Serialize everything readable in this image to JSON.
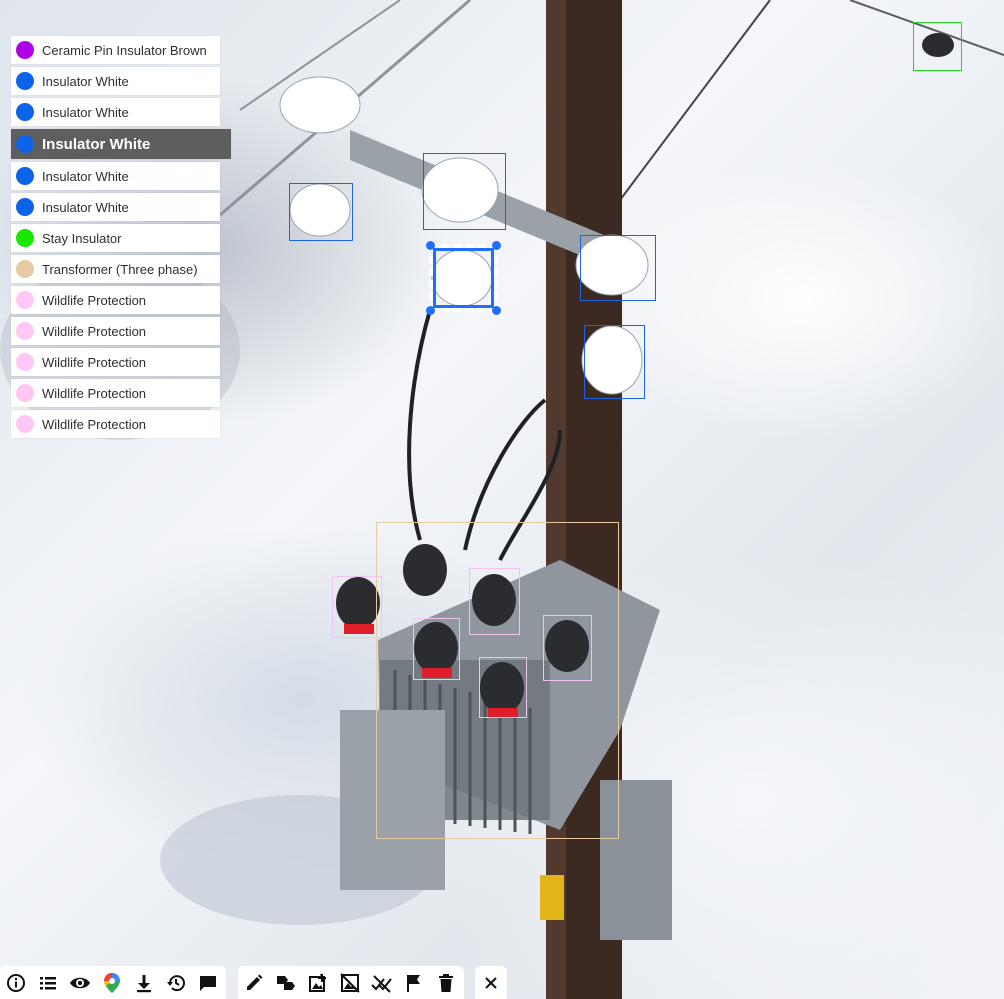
{
  "legend": {
    "items": [
      {
        "label": "Ceramic Pin Insulator Brown",
        "color": "#b000e8"
      },
      {
        "label": "Insulator White",
        "color": "#0a63e8"
      },
      {
        "label": "Insulator White",
        "color": "#0a63e8"
      },
      {
        "label": "Insulator White",
        "color": "#0a63e8",
        "selected": true
      },
      {
        "label": "Insulator White",
        "color": "#0a63e8"
      },
      {
        "label": "Insulator White",
        "color": "#0a63e8"
      },
      {
        "label": "Stay Insulator",
        "color": "#18e800"
      },
      {
        "label": "Transformer (Three phase)",
        "color": "#e6cba2"
      },
      {
        "label": "Wildlife Protection",
        "color": "#ffc8f4"
      },
      {
        "label": "Wildlife Protection",
        "color": "#ffc8f4"
      },
      {
        "label": "Wildlife Protection",
        "color": "#ffc8f4"
      },
      {
        "label": "Wildlife Protection",
        "color": "#ffc8f4"
      },
      {
        "label": "Wildlife Protection",
        "color": "#ffc8f4"
      }
    ]
  },
  "annotations": {
    "insulator_color": "#1f63e0",
    "stay_color": "#22d61a",
    "transformer_color": "#e6cba2",
    "wildlife_color": "#f2c3ee",
    "selected_color": "#1f6fff"
  },
  "toolbar_left": {
    "icons": [
      "info-icon",
      "list-icon",
      "eye-icon",
      "map-pin-icon",
      "download-icon",
      "history-icon",
      "comment-icon"
    ]
  },
  "toolbar_middle": {
    "icons": [
      "pencil-icon",
      "label-switch-icon",
      "image-edit-icon",
      "image-off-icon",
      "remove-marks-icon",
      "flag-icon",
      "trash-icon"
    ]
  },
  "toolbar_right": {
    "icons": [
      "close-icon"
    ]
  }
}
